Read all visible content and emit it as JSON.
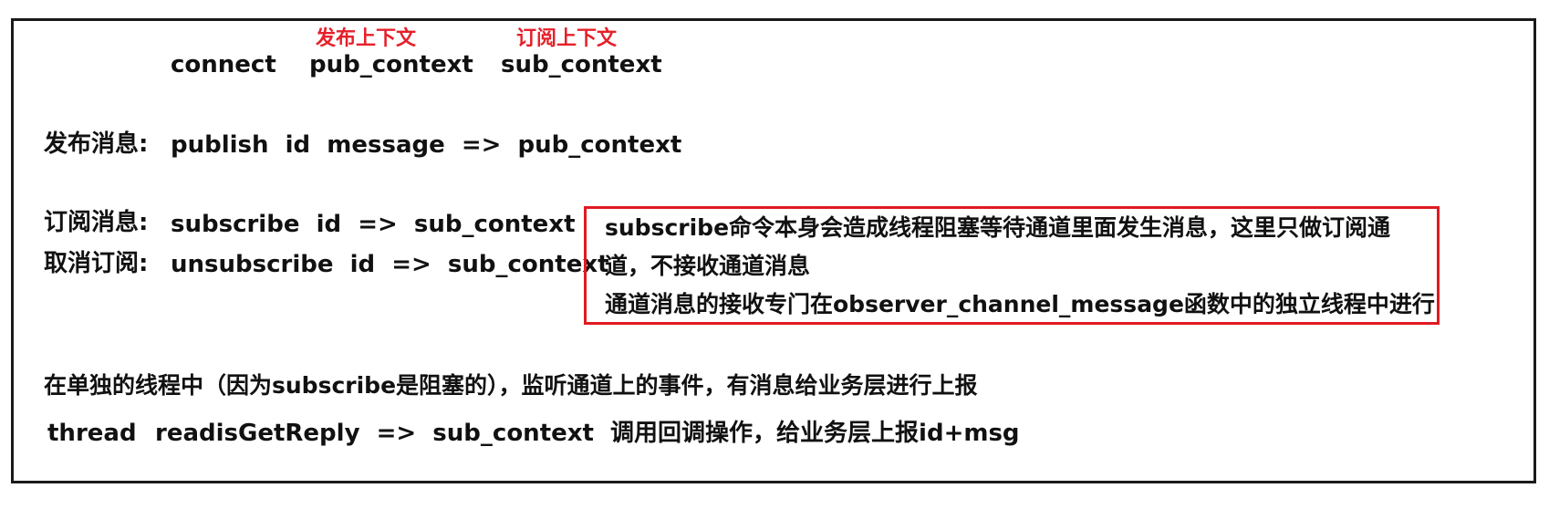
{
  "top_row": {
    "connect": "connect",
    "pub_context": "pub_context",
    "sub_context": "sub_context",
    "pub_label": "发布上下文",
    "sub_label": "订阅上下文"
  },
  "publish": {
    "label": "发布消息:",
    "command": "publish  id  message  =>  pub_context"
  },
  "subscribe": {
    "label": "订阅消息:",
    "command": "subscribe  id  =>  sub_context"
  },
  "unsubscribe": {
    "label": "取消订阅:",
    "command": "unsubscribe  id  =>  sub_context"
  },
  "note": {
    "line1": "subscribe命令本身会造成线程阻塞等待通道里面发生消息，这里只做订阅通",
    "line2": "道，不接收通道消息",
    "line3": "通道消息的接收专门在observer_channel_message函数中的独立线程中进行",
    "border_color": "#e01a22"
  },
  "thread_section": {
    "description": "在单独的线程中（因为subscribe是阻塞的），监听通道上的事件，有消息给业务层进行上报",
    "thread_label": "thread",
    "command": "readisGetReply  =>  sub_context  调用回调操作，给业务层上报id+msg"
  },
  "colors": {
    "accent_red": "#e5202a",
    "text": "#111111",
    "frame": "#1a1a1a"
  }
}
